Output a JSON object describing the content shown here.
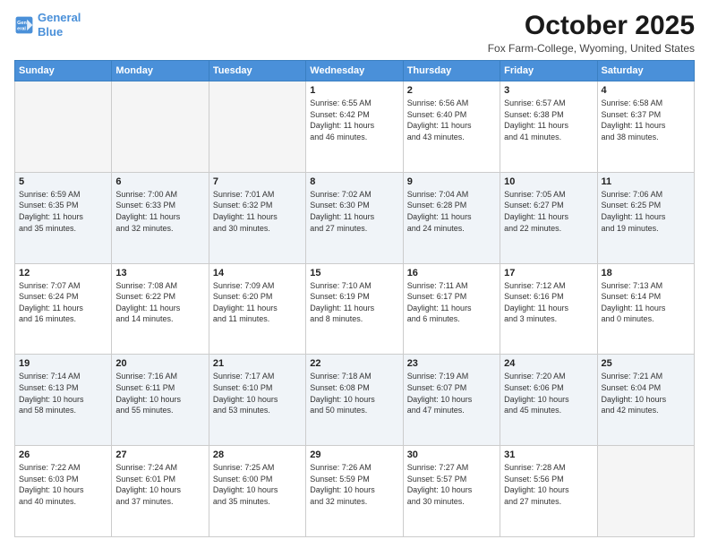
{
  "header": {
    "logo_line1": "General",
    "logo_line2": "Blue",
    "title": "October 2025",
    "location": "Fox Farm-College, Wyoming, United States"
  },
  "weekdays": [
    "Sunday",
    "Monday",
    "Tuesday",
    "Wednesday",
    "Thursday",
    "Friday",
    "Saturday"
  ],
  "weeks": [
    [
      {
        "day": "",
        "info": ""
      },
      {
        "day": "",
        "info": ""
      },
      {
        "day": "",
        "info": ""
      },
      {
        "day": "1",
        "info": "Sunrise: 6:55 AM\nSunset: 6:42 PM\nDaylight: 11 hours\nand 46 minutes."
      },
      {
        "day": "2",
        "info": "Sunrise: 6:56 AM\nSunset: 6:40 PM\nDaylight: 11 hours\nand 43 minutes."
      },
      {
        "day": "3",
        "info": "Sunrise: 6:57 AM\nSunset: 6:38 PM\nDaylight: 11 hours\nand 41 minutes."
      },
      {
        "day": "4",
        "info": "Sunrise: 6:58 AM\nSunset: 6:37 PM\nDaylight: 11 hours\nand 38 minutes."
      }
    ],
    [
      {
        "day": "5",
        "info": "Sunrise: 6:59 AM\nSunset: 6:35 PM\nDaylight: 11 hours\nand 35 minutes."
      },
      {
        "day": "6",
        "info": "Sunrise: 7:00 AM\nSunset: 6:33 PM\nDaylight: 11 hours\nand 32 minutes."
      },
      {
        "day": "7",
        "info": "Sunrise: 7:01 AM\nSunset: 6:32 PM\nDaylight: 11 hours\nand 30 minutes."
      },
      {
        "day": "8",
        "info": "Sunrise: 7:02 AM\nSunset: 6:30 PM\nDaylight: 11 hours\nand 27 minutes."
      },
      {
        "day": "9",
        "info": "Sunrise: 7:04 AM\nSunset: 6:28 PM\nDaylight: 11 hours\nand 24 minutes."
      },
      {
        "day": "10",
        "info": "Sunrise: 7:05 AM\nSunset: 6:27 PM\nDaylight: 11 hours\nand 22 minutes."
      },
      {
        "day": "11",
        "info": "Sunrise: 7:06 AM\nSunset: 6:25 PM\nDaylight: 11 hours\nand 19 minutes."
      }
    ],
    [
      {
        "day": "12",
        "info": "Sunrise: 7:07 AM\nSunset: 6:24 PM\nDaylight: 11 hours\nand 16 minutes."
      },
      {
        "day": "13",
        "info": "Sunrise: 7:08 AM\nSunset: 6:22 PM\nDaylight: 11 hours\nand 14 minutes."
      },
      {
        "day": "14",
        "info": "Sunrise: 7:09 AM\nSunset: 6:20 PM\nDaylight: 11 hours\nand 11 minutes."
      },
      {
        "day": "15",
        "info": "Sunrise: 7:10 AM\nSunset: 6:19 PM\nDaylight: 11 hours\nand 8 minutes."
      },
      {
        "day": "16",
        "info": "Sunrise: 7:11 AM\nSunset: 6:17 PM\nDaylight: 11 hours\nand 6 minutes."
      },
      {
        "day": "17",
        "info": "Sunrise: 7:12 AM\nSunset: 6:16 PM\nDaylight: 11 hours\nand 3 minutes."
      },
      {
        "day": "18",
        "info": "Sunrise: 7:13 AM\nSunset: 6:14 PM\nDaylight: 11 hours\nand 0 minutes."
      }
    ],
    [
      {
        "day": "19",
        "info": "Sunrise: 7:14 AM\nSunset: 6:13 PM\nDaylight: 10 hours\nand 58 minutes."
      },
      {
        "day": "20",
        "info": "Sunrise: 7:16 AM\nSunset: 6:11 PM\nDaylight: 10 hours\nand 55 minutes."
      },
      {
        "day": "21",
        "info": "Sunrise: 7:17 AM\nSunset: 6:10 PM\nDaylight: 10 hours\nand 53 minutes."
      },
      {
        "day": "22",
        "info": "Sunrise: 7:18 AM\nSunset: 6:08 PM\nDaylight: 10 hours\nand 50 minutes."
      },
      {
        "day": "23",
        "info": "Sunrise: 7:19 AM\nSunset: 6:07 PM\nDaylight: 10 hours\nand 47 minutes."
      },
      {
        "day": "24",
        "info": "Sunrise: 7:20 AM\nSunset: 6:06 PM\nDaylight: 10 hours\nand 45 minutes."
      },
      {
        "day": "25",
        "info": "Sunrise: 7:21 AM\nSunset: 6:04 PM\nDaylight: 10 hours\nand 42 minutes."
      }
    ],
    [
      {
        "day": "26",
        "info": "Sunrise: 7:22 AM\nSunset: 6:03 PM\nDaylight: 10 hours\nand 40 minutes."
      },
      {
        "day": "27",
        "info": "Sunrise: 7:24 AM\nSunset: 6:01 PM\nDaylight: 10 hours\nand 37 minutes."
      },
      {
        "day": "28",
        "info": "Sunrise: 7:25 AM\nSunset: 6:00 PM\nDaylight: 10 hours\nand 35 minutes."
      },
      {
        "day": "29",
        "info": "Sunrise: 7:26 AM\nSunset: 5:59 PM\nDaylight: 10 hours\nand 32 minutes."
      },
      {
        "day": "30",
        "info": "Sunrise: 7:27 AM\nSunset: 5:57 PM\nDaylight: 10 hours\nand 30 minutes."
      },
      {
        "day": "31",
        "info": "Sunrise: 7:28 AM\nSunset: 5:56 PM\nDaylight: 10 hours\nand 27 minutes."
      },
      {
        "day": "",
        "info": ""
      }
    ]
  ]
}
